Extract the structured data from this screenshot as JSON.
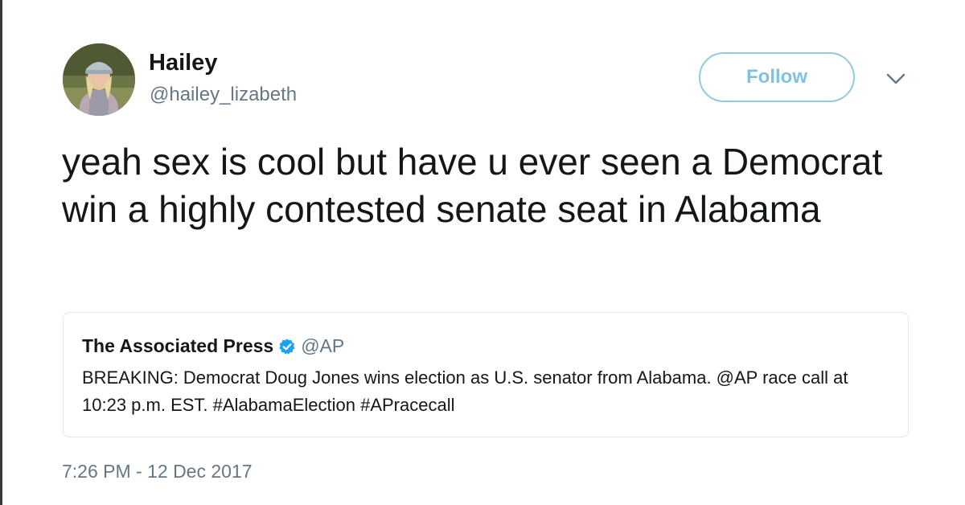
{
  "author": {
    "display_name": "Hailey",
    "handle": "@hailey_lizabeth",
    "avatar_icon": "profile-photo"
  },
  "follow_button": {
    "label": "Follow",
    "color": "#7fc2dd"
  },
  "menu_icon": "chevron-down-icon",
  "tweet": {
    "text": "yeah sex is cool but have u ever seen a Democrat win a highly contested senate seat in Alabama"
  },
  "quoted_tweet": {
    "display_name": "The Associated Press",
    "verified": true,
    "verified_color": "#1da1f2",
    "handle": "@AP",
    "text": "BREAKING: Democrat Doug Jones wins election as U.S. senator from Alabama. @AP race call at 10:23 p.m. EST. #AlabamaElection #APracecall"
  },
  "timestamp": "7:26 PM - 12 Dec 2017"
}
